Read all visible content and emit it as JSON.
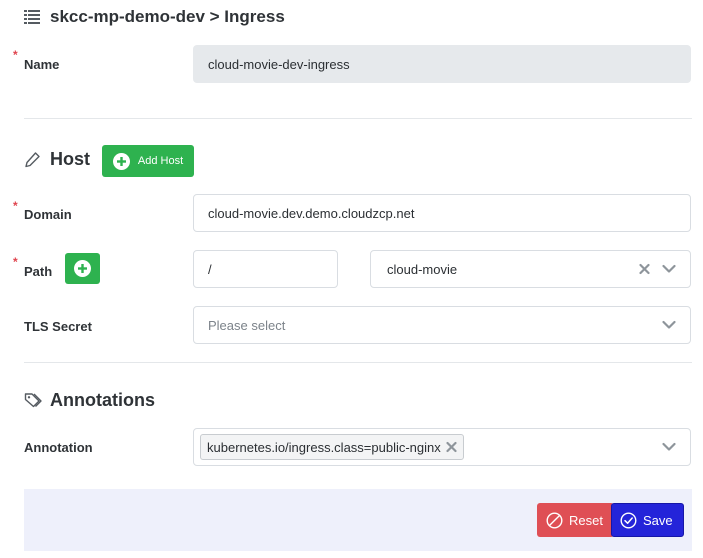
{
  "header": {
    "title": "skcc-mp-demo-dev > Ingress",
    "icon": "list-icon"
  },
  "name": {
    "label": "Name",
    "value": "cloud-movie-dev-ingress",
    "required_mark": "*"
  },
  "host": {
    "title": "Host",
    "icon": "pencil-icon",
    "add_host_label": "Add Host"
  },
  "domain": {
    "label": "Domain",
    "value": "cloud-movie.dev.demo.cloudzcp.net",
    "required_mark": "*"
  },
  "path": {
    "label": "Path",
    "path_value": "/",
    "service_value": "cloud-movie",
    "required_mark": "*"
  },
  "tls": {
    "label": "TLS Secret",
    "placeholder": "Please select"
  },
  "annotations": {
    "title": "Annotations",
    "icon": "tags-icon",
    "label": "Annotation",
    "tags": [
      "kubernetes.io/ingress.class=public-nginx"
    ]
  },
  "footer": {
    "reset_label": "Reset",
    "save_label": "Save"
  },
  "colors": {
    "green": "#2eb24f",
    "reset": "#df4f55",
    "save": "#2424d9",
    "required": "#e0454f",
    "footer_bg": "#eef0fb"
  }
}
